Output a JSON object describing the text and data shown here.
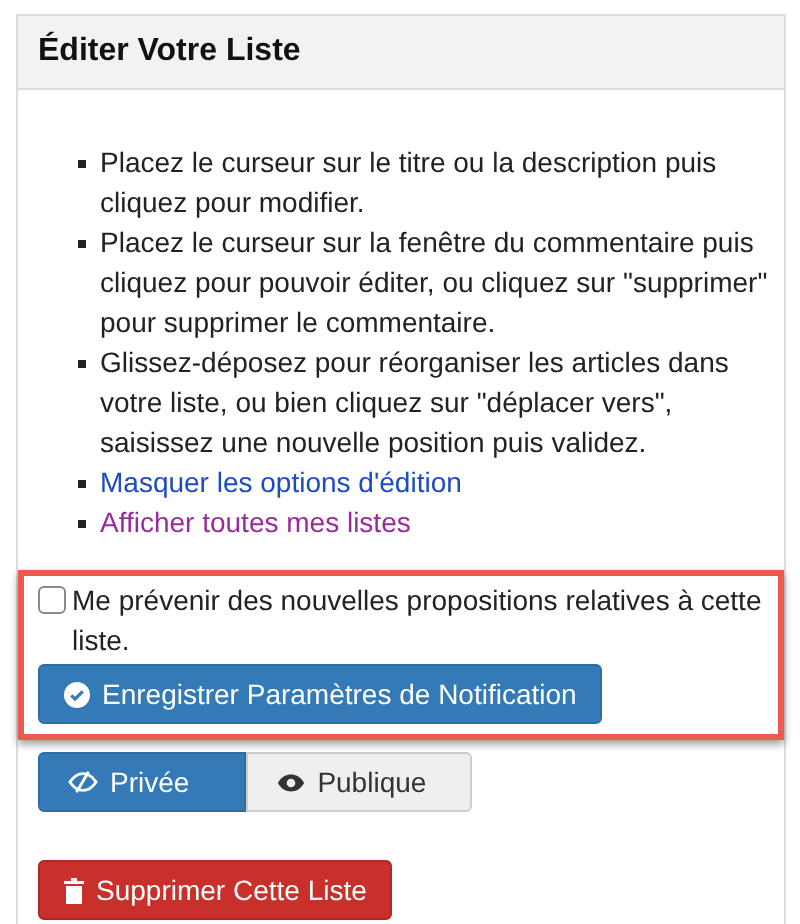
{
  "panel": {
    "title": "Éditer Votre Liste"
  },
  "instructions": [
    {
      "kind": "text",
      "text": "Placez le curseur sur le titre ou la description puis cliquez pour modifier."
    },
    {
      "kind": "text",
      "text": "Placez le curseur sur la fenêtre du commentaire puis cliquez pour pouvoir éditer, ou cliquez sur \"supprimer\" pour supprimer le commentaire."
    },
    {
      "kind": "text",
      "text": "Glissez-déposez pour réorganiser les articles dans votre liste, ou bien cliquez sur \"déplacer vers\", saisissez une nouvelle position puis validez."
    },
    {
      "kind": "link",
      "text": "Masquer les options d'édition",
      "visited": false
    },
    {
      "kind": "link",
      "text": "Afficher toutes mes listes",
      "visited": true
    }
  ],
  "notification": {
    "highlighted": true,
    "checkbox": {
      "label": "Me prévenir des nouvelles propositions relatives à cette liste.",
      "checked": false
    },
    "save_button": "Enregistrer Paramètres de Notification"
  },
  "visibility": [
    {
      "label": "Privée",
      "selected": true
    },
    {
      "label": "Publique",
      "selected": false
    }
  ],
  "delete_button": "Supprimer Cette Liste"
}
